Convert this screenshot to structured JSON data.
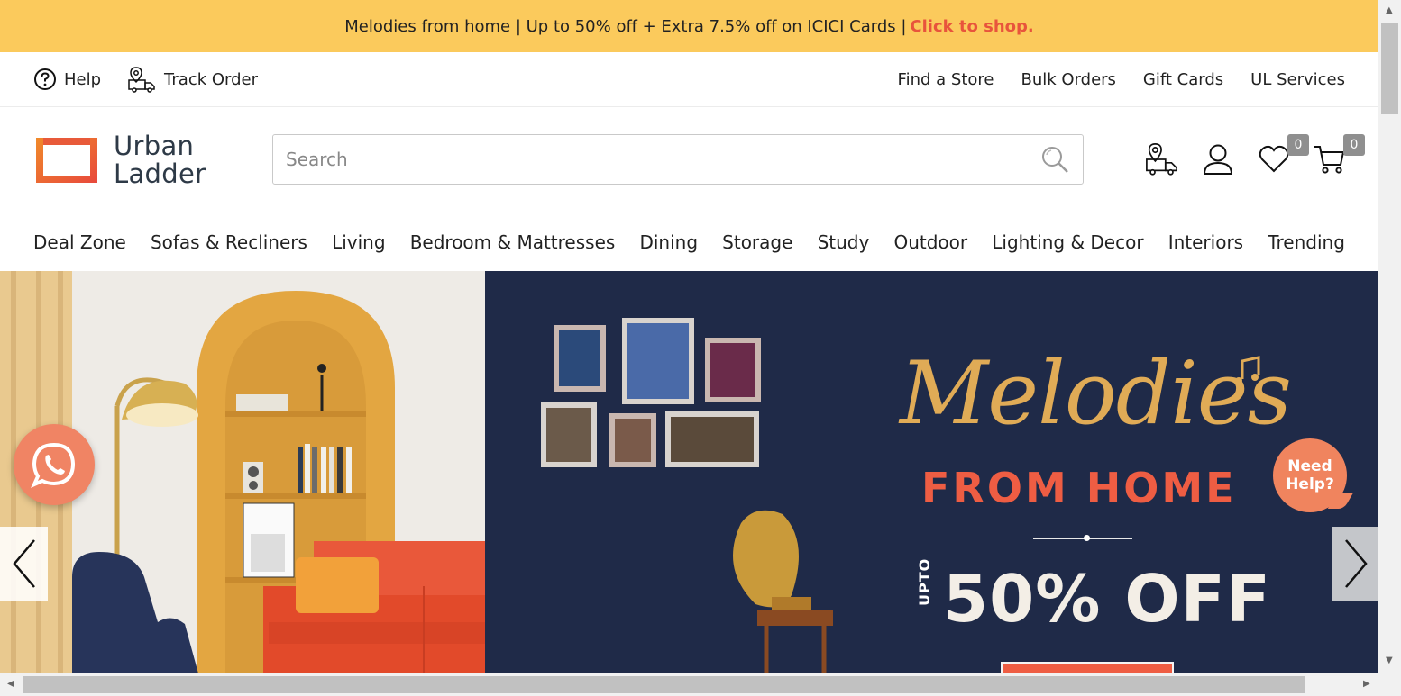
{
  "promo": {
    "text": "Melodies from home | Up to 50% off + Extra 7.5% off on ICICI Cards | ",
    "cta": "Click to shop."
  },
  "utility": {
    "help": "Help",
    "track_order": "Track Order",
    "links": [
      "Find a Store",
      "Bulk Orders",
      "Gift Cards",
      "UL Services"
    ]
  },
  "logo": {
    "line1": "Urban",
    "line2": "Ladder"
  },
  "search": {
    "placeholder": "Search"
  },
  "header": {
    "wishlist_count": "0",
    "cart_count": "0"
  },
  "nav": {
    "items": [
      "Deal Zone",
      "Sofas & Recliners",
      "Living",
      "Bedroom & Mattresses",
      "Dining",
      "Storage",
      "Study",
      "Outdoor",
      "Lighting & Decor",
      "Interiors",
      "Trending"
    ]
  },
  "hero": {
    "title_script": "Melodies",
    "title_sub": "FROM HOME",
    "upto": "UPTO",
    "offer": "50% OFF"
  },
  "help_bubble": {
    "line1": "Need",
    "line2": "Help?"
  },
  "colors": {
    "promo_bg": "#fbca5c",
    "accent": "#ee5d43",
    "hero_navy": "#1f2a48",
    "gold": "#e0ab56"
  }
}
